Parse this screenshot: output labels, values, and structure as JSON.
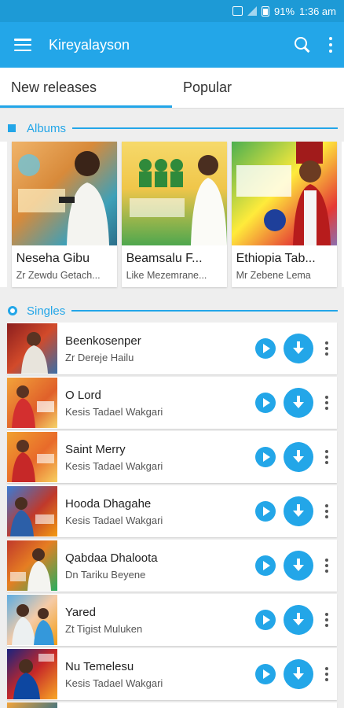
{
  "status_bar": {
    "battery": "91%",
    "time": "1:36 am"
  },
  "app_bar": {
    "title": "Kireyalayson"
  },
  "tabs": [
    {
      "label": "New releases",
      "active": true
    },
    {
      "label": "Popular",
      "active": false
    }
  ],
  "albums_section": {
    "title": "Albums"
  },
  "albums": [
    {
      "title": "Neseha Gibu",
      "artist": "Zr Zewdu Getach..."
    },
    {
      "title": "Beamsalu F...",
      "artist": "Like Mezemrane..."
    },
    {
      "title": "Ethiopia Tab...",
      "artist": "Mr Zebene Lema"
    }
  ],
  "singles_section": {
    "title": "Singles"
  },
  "singles": [
    {
      "title": "Beenkosenper",
      "artist": "Zr Dereje Hailu"
    },
    {
      "title": "O Lord",
      "artist": "Kesis Tadael Wakgari"
    },
    {
      "title": "Saint Merry",
      "artist": "Kesis Tadael Wakgari"
    },
    {
      "title": "Hooda Dhagahe",
      "artist": "Kesis Tadael Wakgari"
    },
    {
      "title": "Qabdaa Dhaloota",
      "artist": "Dn Tariku Beyene"
    },
    {
      "title": "Yared",
      "artist": "Zt Tigist Muluken"
    },
    {
      "title": "Nu Temelesu",
      "artist": "Kesis Tadael Wakgari"
    }
  ],
  "colors": {
    "primary": "#23a6e8",
    "status_bar": "#1d9ad6"
  }
}
